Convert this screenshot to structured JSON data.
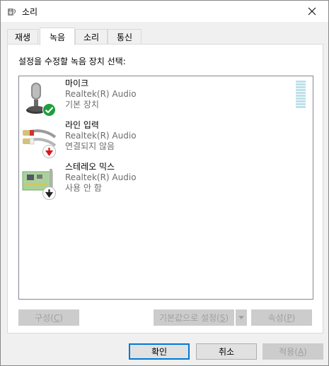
{
  "window": {
    "title": "소리",
    "icon": "speaker-icon",
    "close_icon": "close-icon"
  },
  "tabs": [
    {
      "label": "재생",
      "active": false
    },
    {
      "label": "녹음",
      "active": true
    },
    {
      "label": "소리",
      "active": false
    },
    {
      "label": "통신",
      "active": false
    }
  ],
  "main": {
    "instruction": "설정을 수정할 녹음 장치 선택:",
    "devices": [
      {
        "name": "마이크",
        "driver": "Realtek(R) Audio",
        "status": "기본 장치",
        "icon": "microphone-icon",
        "badge": "default-check-badge",
        "badge_color": "#1f9e3c",
        "level": 0
      },
      {
        "name": "라인 입력",
        "driver": "Realtek(R) Audio",
        "status": "연결되지 않음",
        "icon": "line-in-cable-icon",
        "badge": "not-plugged-in-badge",
        "badge_color": "#d9171d"
      },
      {
        "name": "스테레오 믹스",
        "driver": "Realtek(R) Audio",
        "status": "사용 안 함",
        "icon": "sound-card-icon",
        "badge": "disabled-badge",
        "badge_color": "#222222"
      }
    ]
  },
  "buttons": {
    "configure": {
      "label": "구성",
      "access_key": "C"
    },
    "set_default": {
      "label": "기본값으로 설정",
      "access_key": "S"
    },
    "properties": {
      "label": "속성",
      "access_key": "P"
    },
    "ok": "확인",
    "cancel": "취소",
    "apply": {
      "label": "적용",
      "access_key": "A"
    }
  },
  "colors": {
    "accent": "#0078d7",
    "level_meter": "#bfe0e8"
  }
}
